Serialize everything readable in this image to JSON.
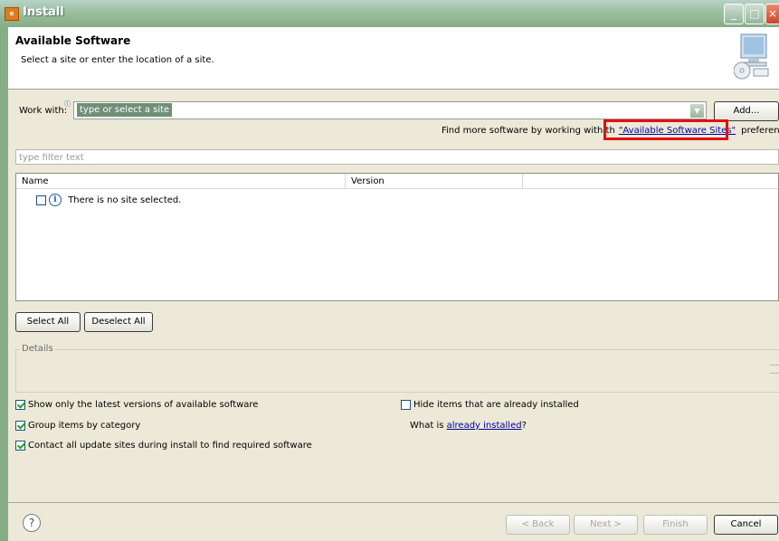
{
  "window": {
    "title": "Install",
    "title_icon": "eclipse-install-icon"
  },
  "header": {
    "title": "Available Software",
    "description": "Select a site or enter the location of a site."
  },
  "work_with": {
    "label": "Work with:",
    "value": "type or select a site",
    "add_button": "Add..."
  },
  "find_more": {
    "prefix": "Find more software by working with th",
    "link": "\"Available Software Sites\"",
    "suffix": "preferences."
  },
  "filter": {
    "placeholder": "type filter text"
  },
  "tree": {
    "columns": [
      "Name",
      "Version"
    ],
    "rows": [
      {
        "label": "There is no site selected.",
        "checked": false
      }
    ]
  },
  "buttons": {
    "select_all": "Select All",
    "deselect_all": "Deselect All"
  },
  "details": {
    "label": "Details"
  },
  "options": {
    "show_latest": {
      "label": "Show only the latest versions of available software",
      "checked": true
    },
    "group_by_category": {
      "label": "Group items by category",
      "checked": true
    },
    "contact_sites": {
      "label": "Contact all update sites during install to find required software",
      "checked": true
    },
    "hide_installed": {
      "label": "Hide items that are already installed",
      "checked": false
    },
    "what_is_prefix": "What is ",
    "what_is_link": "already installed",
    "what_is_suffix": "?"
  },
  "footer": {
    "back": "< Back",
    "next": "Next >",
    "finish": "Finish",
    "cancel": "Cancel"
  },
  "colors": {
    "highlight": "#e41010",
    "title_bar": "#9bbf9f",
    "link": "#00009b"
  }
}
